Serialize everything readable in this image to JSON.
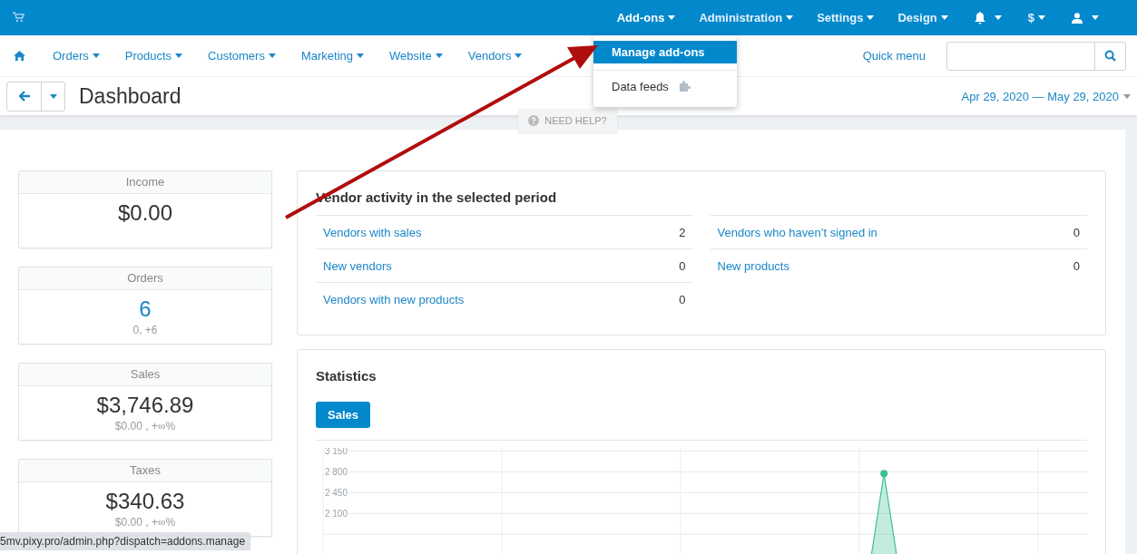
{
  "top_bar": {
    "menus": [
      {
        "label": "Add-ons",
        "selected": true
      },
      {
        "label": "Administration",
        "selected": false
      },
      {
        "label": "Settings",
        "selected": false
      },
      {
        "label": "Design",
        "selected": false
      }
    ],
    "currency": "$"
  },
  "dropdown": {
    "items": [
      {
        "label": "Manage add-ons",
        "selected": true
      },
      {
        "label": "Data feeds",
        "selected": false
      }
    ]
  },
  "nav": {
    "items": [
      "Orders",
      "Products",
      "Customers",
      "Marketing",
      "Website",
      "Vendors"
    ],
    "quick_menu": "Quick menu"
  },
  "page": {
    "title": "Dashboard",
    "date_range": "Apr 29, 2020 — May 29, 2020",
    "help": "NEED HELP?"
  },
  "stat_cards": [
    {
      "title": "Income",
      "value": "$0.00",
      "kind": "amount"
    },
    {
      "title": "Orders",
      "value": "6",
      "kind": "link",
      "sub": "0, +6"
    },
    {
      "title": "Sales",
      "value": "$3,746.89",
      "kind": "amount",
      "sub": "$0.00 , +∞%"
    },
    {
      "title": "Taxes",
      "value": "$340.63",
      "kind": "amount",
      "sub": "$0.00 , +∞%"
    }
  ],
  "vendor_activity": {
    "title": "Vendor activity in the selected period",
    "columns": [
      [
        {
          "label": "Vendors with sales",
          "count": "2"
        },
        {
          "label": "New vendors",
          "count": "0"
        },
        {
          "label": "Vendors with new products",
          "count": "0"
        }
      ],
      [
        {
          "label": "Vendors who haven’t signed in",
          "count": "0"
        },
        {
          "label": "New products",
          "count": "0"
        }
      ]
    ]
  },
  "statistics": {
    "title": "Statistics",
    "tabs": [
      {
        "selected": true
      }
    ],
    "chart_data": {
      "type": "area",
      "ylim": [
        0,
        3200
      ],
      "grid": true,
      "yticks": [
        2100,
        2450,
        2800,
        3150
      ],
      "series": [
        {
          "name": "Sales",
          "color": "#3cc08f",
          "values": [
            0,
            0,
            0,
            0,
            0,
            0,
            0,
            0,
            0,
            0,
            0,
            0,
            0,
            0,
            0,
            0,
            0,
            0,
            0,
            0,
            0,
            0,
            2770,
            0,
            0,
            0,
            0,
            0,
            0,
            0,
            0
          ]
        }
      ]
    }
  },
  "status_url": "5mv.pixy.pro/admin.php?dispatch=addons.manage"
}
